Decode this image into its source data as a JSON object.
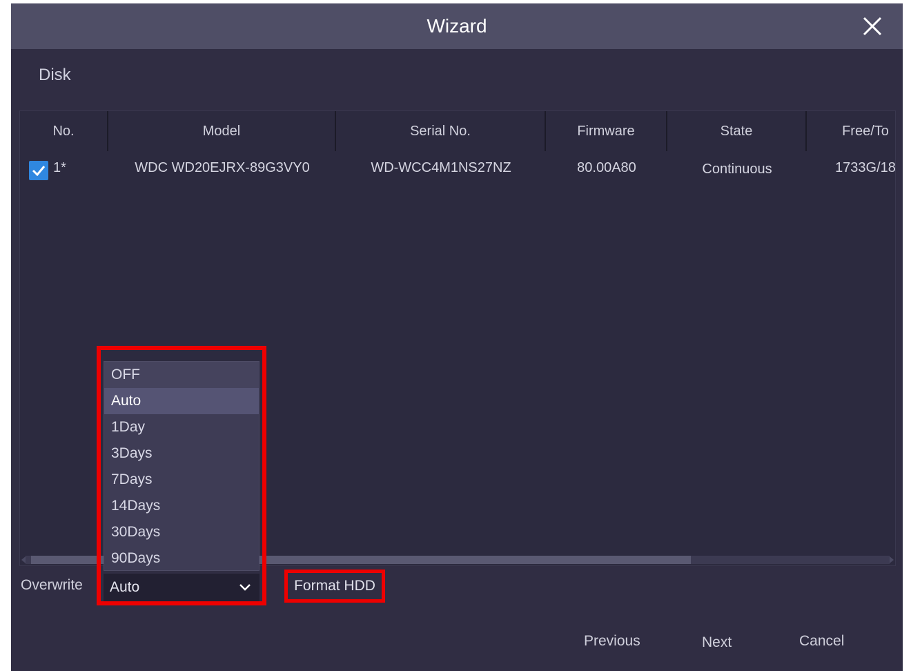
{
  "window": {
    "title": "Wizard",
    "close_icon": "close-icon"
  },
  "section": {
    "label": "Disk"
  },
  "table": {
    "headers": [
      "No.",
      "Model",
      "Serial No.",
      "Firmware",
      "State",
      "Free/To"
    ],
    "rows": [
      {
        "checked": true,
        "no": "1*",
        "model": "WDC WD20EJRX-89G3VY0",
        "serial": "WD-WCC4M1NS27NZ",
        "firmware": "80.00A80",
        "state": "Continuous",
        "free_total": "1733G/18"
      }
    ]
  },
  "overwrite": {
    "label": "Overwrite",
    "selected": "Auto",
    "options": [
      "OFF",
      "Auto",
      "1Day",
      "3Days",
      "7Days",
      "14Days",
      "30Days",
      "90Days"
    ]
  },
  "format_button": "Format HDD",
  "footer": {
    "previous": "Previous",
    "next": "Next",
    "cancel": "Cancel"
  },
  "colors": {
    "accent": "#2f87e0",
    "highlight": "#ee0000",
    "title_bar": "#4f4e66",
    "panel": "#302d43"
  }
}
